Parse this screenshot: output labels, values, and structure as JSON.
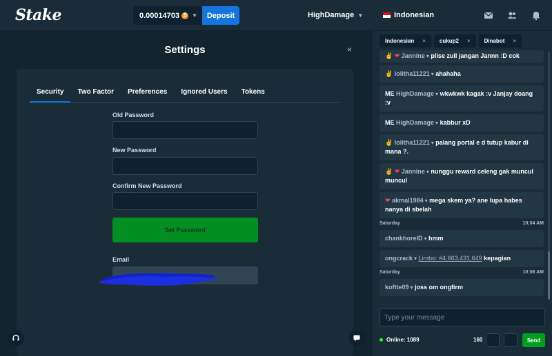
{
  "header": {
    "logo": "Stake",
    "balance": "0.00014703",
    "coin_symbol": "₿",
    "deposit_label": "Deposit",
    "username": "HighDamage",
    "language": "Indonesian",
    "icons": [
      "mail-icon",
      "users-icon",
      "bell-icon"
    ]
  },
  "settings": {
    "title": "Settings",
    "close": "×",
    "tabs": [
      "Security",
      "Two Factor",
      "Preferences",
      "Ignored Users",
      "Tokens"
    ],
    "active_tab": "Security",
    "old_password_label": "Old Password",
    "new_password_label": "New Password",
    "confirm_password_label": "Confirm New Password",
    "set_password_label": "Set Password",
    "email_label": "Email",
    "email_value": ""
  },
  "chat": {
    "tabs": [
      {
        "label": "Indonesian",
        "close": "×"
      },
      {
        "label": "cukup2",
        "close": "×"
      },
      {
        "label": "Dinabot",
        "close": "×"
      }
    ],
    "messages": [
      {
        "prefix": "✌",
        "heart": "❤",
        "user": "Jannine",
        "text": "plise zull jangan Jannn :D cok"
      },
      {
        "prefix": "✌",
        "heart": "",
        "user": "lolitha11221",
        "text": "ahahaha"
      },
      {
        "me": "ME",
        "user": "HighDamage",
        "text": "wkwkwk kagak :v Janjay doang :v"
      },
      {
        "me": "ME",
        "user": "HighDamage",
        "text": "kabbur xD"
      },
      {
        "prefix": "✌",
        "heart": "",
        "user": "lolitha11221",
        "text": "palang portal e d tutup kabur di mana ?."
      },
      {
        "prefix": "✌",
        "heart": "❤",
        "user": "Jannine",
        "text": "nunggu reward celeng gak muncul muncul"
      },
      {
        "prefix": "",
        "heart": "❤",
        "user": "akmal1984",
        "text": "mega skem ya? ane lupa habes nanya di sbelah"
      }
    ],
    "separator1": {
      "day": "Saturday",
      "time": "10:04 AM"
    },
    "messages2": [
      {
        "user": "chankhoreID",
        "text": "hmm"
      },
      {
        "user": "ongcrack",
        "link": "Limbo: #4,663,431,649",
        "text": "kepagian"
      }
    ],
    "separator2": {
      "day": "Saturday",
      "time": "10:06 AM"
    },
    "messages3": [
      {
        "user": "koftte09",
        "text": "joss om ongfirm"
      }
    ],
    "input_placeholder": "Type your message",
    "online_label": "Online: 1089",
    "char_count": "160",
    "send_label": "Send"
  }
}
